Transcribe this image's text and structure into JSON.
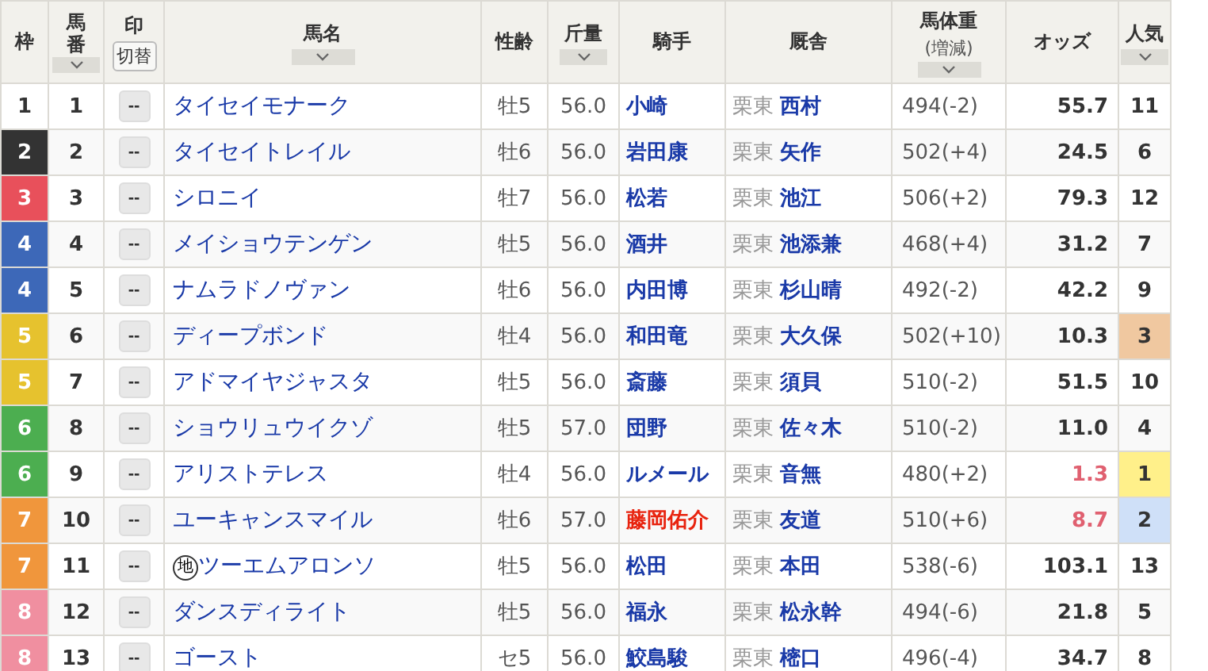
{
  "columns": [
    {
      "label": "枠",
      "sortable": false
    },
    {
      "label": "馬番",
      "sortable": true
    },
    {
      "label": "印",
      "button": "切替",
      "sortable": false
    },
    {
      "label": "馬名",
      "sortable": true
    },
    {
      "label": "性齢",
      "sortable": false
    },
    {
      "label": "斤量",
      "sortable": true
    },
    {
      "label": "騎手",
      "sortable": false
    },
    {
      "label": "厩舎",
      "sortable": false
    },
    {
      "label": "馬体重",
      "sublabel": "(増減)",
      "sortable": true
    },
    {
      "label": "オッズ",
      "sortable": false
    },
    {
      "label": "人気",
      "sortable": true
    }
  ],
  "rows": [
    {
      "frame": "1",
      "color": "#ffffff",
      "number": "1",
      "mark": "--",
      "name": "タイセイモナーク",
      "sex_age": "牡5",
      "weight": "56.0",
      "jockey": "小崎",
      "jockey_highlight": false,
      "region": "栗東",
      "trainer": "西村",
      "body_weight": "494(-2)",
      "odds": "55.7",
      "odds_hot": false,
      "popularity": {
        "text": "11"
      }
    },
    {
      "frame": "2",
      "color": "#333333",
      "number": "2",
      "mark": "--",
      "name": "タイセイトレイル",
      "sex_age": "牡6",
      "weight": "56.0",
      "jockey": "岩田康",
      "jockey_highlight": false,
      "region": "栗東",
      "trainer": "矢作",
      "body_weight": "502(+4)",
      "odds": "24.5",
      "odds_hot": false,
      "popularity": {
        "text": "6"
      }
    },
    {
      "frame": "3",
      "color": "#e8505b",
      "number": "3",
      "mark": "--",
      "name": "シロニイ",
      "sex_age": "牡7",
      "weight": "56.0",
      "jockey": "松若",
      "jockey_highlight": false,
      "region": "栗東",
      "trainer": "池江",
      "body_weight": "506(+2)",
      "odds": "79.3",
      "odds_hot": false,
      "popularity": {
        "text": "12"
      }
    },
    {
      "frame": "4",
      "color": "#3d68b8",
      "number": "4",
      "mark": "--",
      "name": "メイショウテンゲン",
      "sex_age": "牡5",
      "weight": "56.0",
      "jockey": "酒井",
      "jockey_highlight": false,
      "region": "栗東",
      "trainer": "池添兼",
      "body_weight": "468(+4)",
      "odds": "31.2",
      "odds_hot": false,
      "popularity": {
        "text": "7"
      }
    },
    {
      "frame": "4",
      "color": "#3d68b8",
      "number": "5",
      "mark": "--",
      "name": "ナムラドノヴァン",
      "sex_age": "牡6",
      "weight": "56.0",
      "jockey": "内田博",
      "jockey_highlight": false,
      "region": "栗東",
      "trainer": "杉山晴",
      "body_weight": "492(-2)",
      "odds": "42.2",
      "odds_hot": false,
      "popularity": {
        "text": "9"
      }
    },
    {
      "frame": "5",
      "color": "#e6c22e",
      "number": "6",
      "mark": "--",
      "name": "ディープボンド",
      "sex_age": "牡4",
      "weight": "56.0",
      "jockey": "和田竜",
      "jockey_highlight": false,
      "region": "栗東",
      "trainer": "大久保",
      "body_weight": "502(+10)",
      "odds": "10.3",
      "odds_hot": false,
      "popularity": {
        "text": "3",
        "color": "#f0c8a0"
      }
    },
    {
      "frame": "5",
      "color": "#e6c22e",
      "number": "7",
      "mark": "--",
      "name": "アドマイヤジャスタ",
      "sex_age": "牡5",
      "weight": "56.0",
      "jockey": "斎藤",
      "jockey_highlight": false,
      "region": "栗東",
      "trainer": "須貝",
      "body_weight": "510(-2)",
      "odds": "51.5",
      "odds_hot": false,
      "popularity": {
        "text": "10"
      }
    },
    {
      "frame": "6",
      "color": "#4cae50",
      "number": "8",
      "mark": "--",
      "name": "ショウリュウイクゾ",
      "sex_age": "牡5",
      "weight": "57.0",
      "jockey": "団野",
      "jockey_highlight": false,
      "region": "栗東",
      "trainer": "佐々木",
      "body_weight": "510(-2)",
      "odds": "11.0",
      "odds_hot": false,
      "popularity": {
        "text": "4"
      }
    },
    {
      "frame": "6",
      "color": "#4cae50",
      "number": "9",
      "mark": "--",
      "name": "アリストテレス",
      "sex_age": "牡4",
      "weight": "56.0",
      "jockey": "ルメール",
      "jockey_highlight": false,
      "region": "栗東",
      "trainer": "音無",
      "body_weight": "480(+2)",
      "odds": "1.3",
      "odds_hot": true,
      "popularity": {
        "text": "1",
        "color": "#fff08a"
      }
    },
    {
      "frame": "7",
      "color": "#f0963c",
      "number": "10",
      "mark": "--",
      "name": "ユーキャンスマイル",
      "sex_age": "牡6",
      "weight": "57.0",
      "jockey": "藤岡佑介",
      "jockey_highlight": true,
      "region": "栗東",
      "trainer": "友道",
      "body_weight": "510(+6)",
      "odds": "8.7",
      "odds_hot": true,
      "popularity": {
        "text": "2",
        "color": "#cfe0f8"
      }
    },
    {
      "frame": "7",
      "color": "#f0963c",
      "number": "11",
      "mark": "--",
      "badge": "地",
      "name": "ツーエムアロンソ",
      "sex_age": "牡5",
      "weight": "56.0",
      "jockey": "松田",
      "jockey_highlight": false,
      "region": "栗東",
      "trainer": "本田",
      "body_weight": "538(-6)",
      "odds": "103.1",
      "odds_hot": false,
      "popularity": {
        "text": "13"
      }
    },
    {
      "frame": "8",
      "color": "#f08fa0",
      "number": "12",
      "mark": "--",
      "name": "ダンスディライト",
      "sex_age": "牡5",
      "weight": "56.0",
      "jockey": "福永",
      "jockey_highlight": false,
      "region": "栗東",
      "trainer": "松永幹",
      "body_weight": "494(-6)",
      "odds": "21.8",
      "odds_hot": false,
      "popularity": {
        "text": "5"
      }
    },
    {
      "frame": "8",
      "color": "#f08fa0",
      "number": "13",
      "mark": "--",
      "name": "ゴースト",
      "sex_age": "セ5",
      "weight": "56.0",
      "jockey": "鮫島駿",
      "jockey_highlight": false,
      "region": "栗東",
      "trainer": "樒口",
      "body_weight": "496(-4)",
      "odds": "34.7",
      "odds_hot": false,
      "popularity": {
        "text": "8"
      }
    }
  ]
}
